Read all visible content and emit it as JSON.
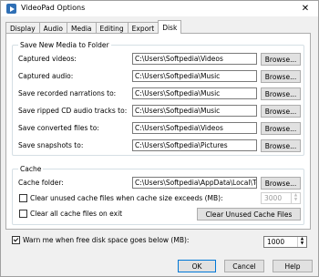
{
  "window": {
    "title": "VideoPad Options",
    "close": "✕"
  },
  "tabs": [
    "Display",
    "Audio",
    "Media",
    "Editing",
    "Export",
    "Disk"
  ],
  "media_group": {
    "title": "Save New Media to Folder",
    "rows": [
      {
        "label": "Captured videos:",
        "path": "C:\\Users\\Softpedia\\Videos",
        "button": "Browse..."
      },
      {
        "label": "Captured audio:",
        "path": "C:\\Users\\Softpedia\\Music",
        "button": "Browse..."
      },
      {
        "label": "Save recorded narrations to:",
        "path": "C:\\Users\\Softpedia\\Music",
        "button": "Browse..."
      },
      {
        "label": "Save ripped CD audio tracks to:",
        "path": "C:\\Users\\Softpedia\\Music",
        "button": "Browse..."
      },
      {
        "label": "Save converted files to:",
        "path": "C:\\Users\\Softpedia\\Videos",
        "button": "Browse..."
      },
      {
        "label": "Save snapshots to:",
        "path": "C:\\Users\\Softpedia\\Pictures",
        "button": "Browse..."
      }
    ]
  },
  "cache_group": {
    "title": "Cache",
    "folder_label": "Cache folder:",
    "folder_path": "C:\\Users\\Softpedia\\AppData\\Local\\Temp\\",
    "browse": "Browse...",
    "clear_exceeds_label": "Clear unused cache files when cache size exceeds (MB):",
    "clear_exceeds_checked": false,
    "cache_size_value": "3000",
    "clear_exit_label": "Clear all cache files on exit",
    "clear_exit_checked": false,
    "clear_unused_button": "Clear Unused Cache Files"
  },
  "warn": {
    "label": "Warn me when free disk space goes below (MB):",
    "checked": true,
    "value": "1000"
  },
  "footer": {
    "ok": "OK",
    "cancel": "Cancel",
    "help": "Help"
  },
  "colors": {
    "focus_border": "#0078d7",
    "title_bar": "#ffffff",
    "dialog_bg": "#f0f0f0"
  }
}
